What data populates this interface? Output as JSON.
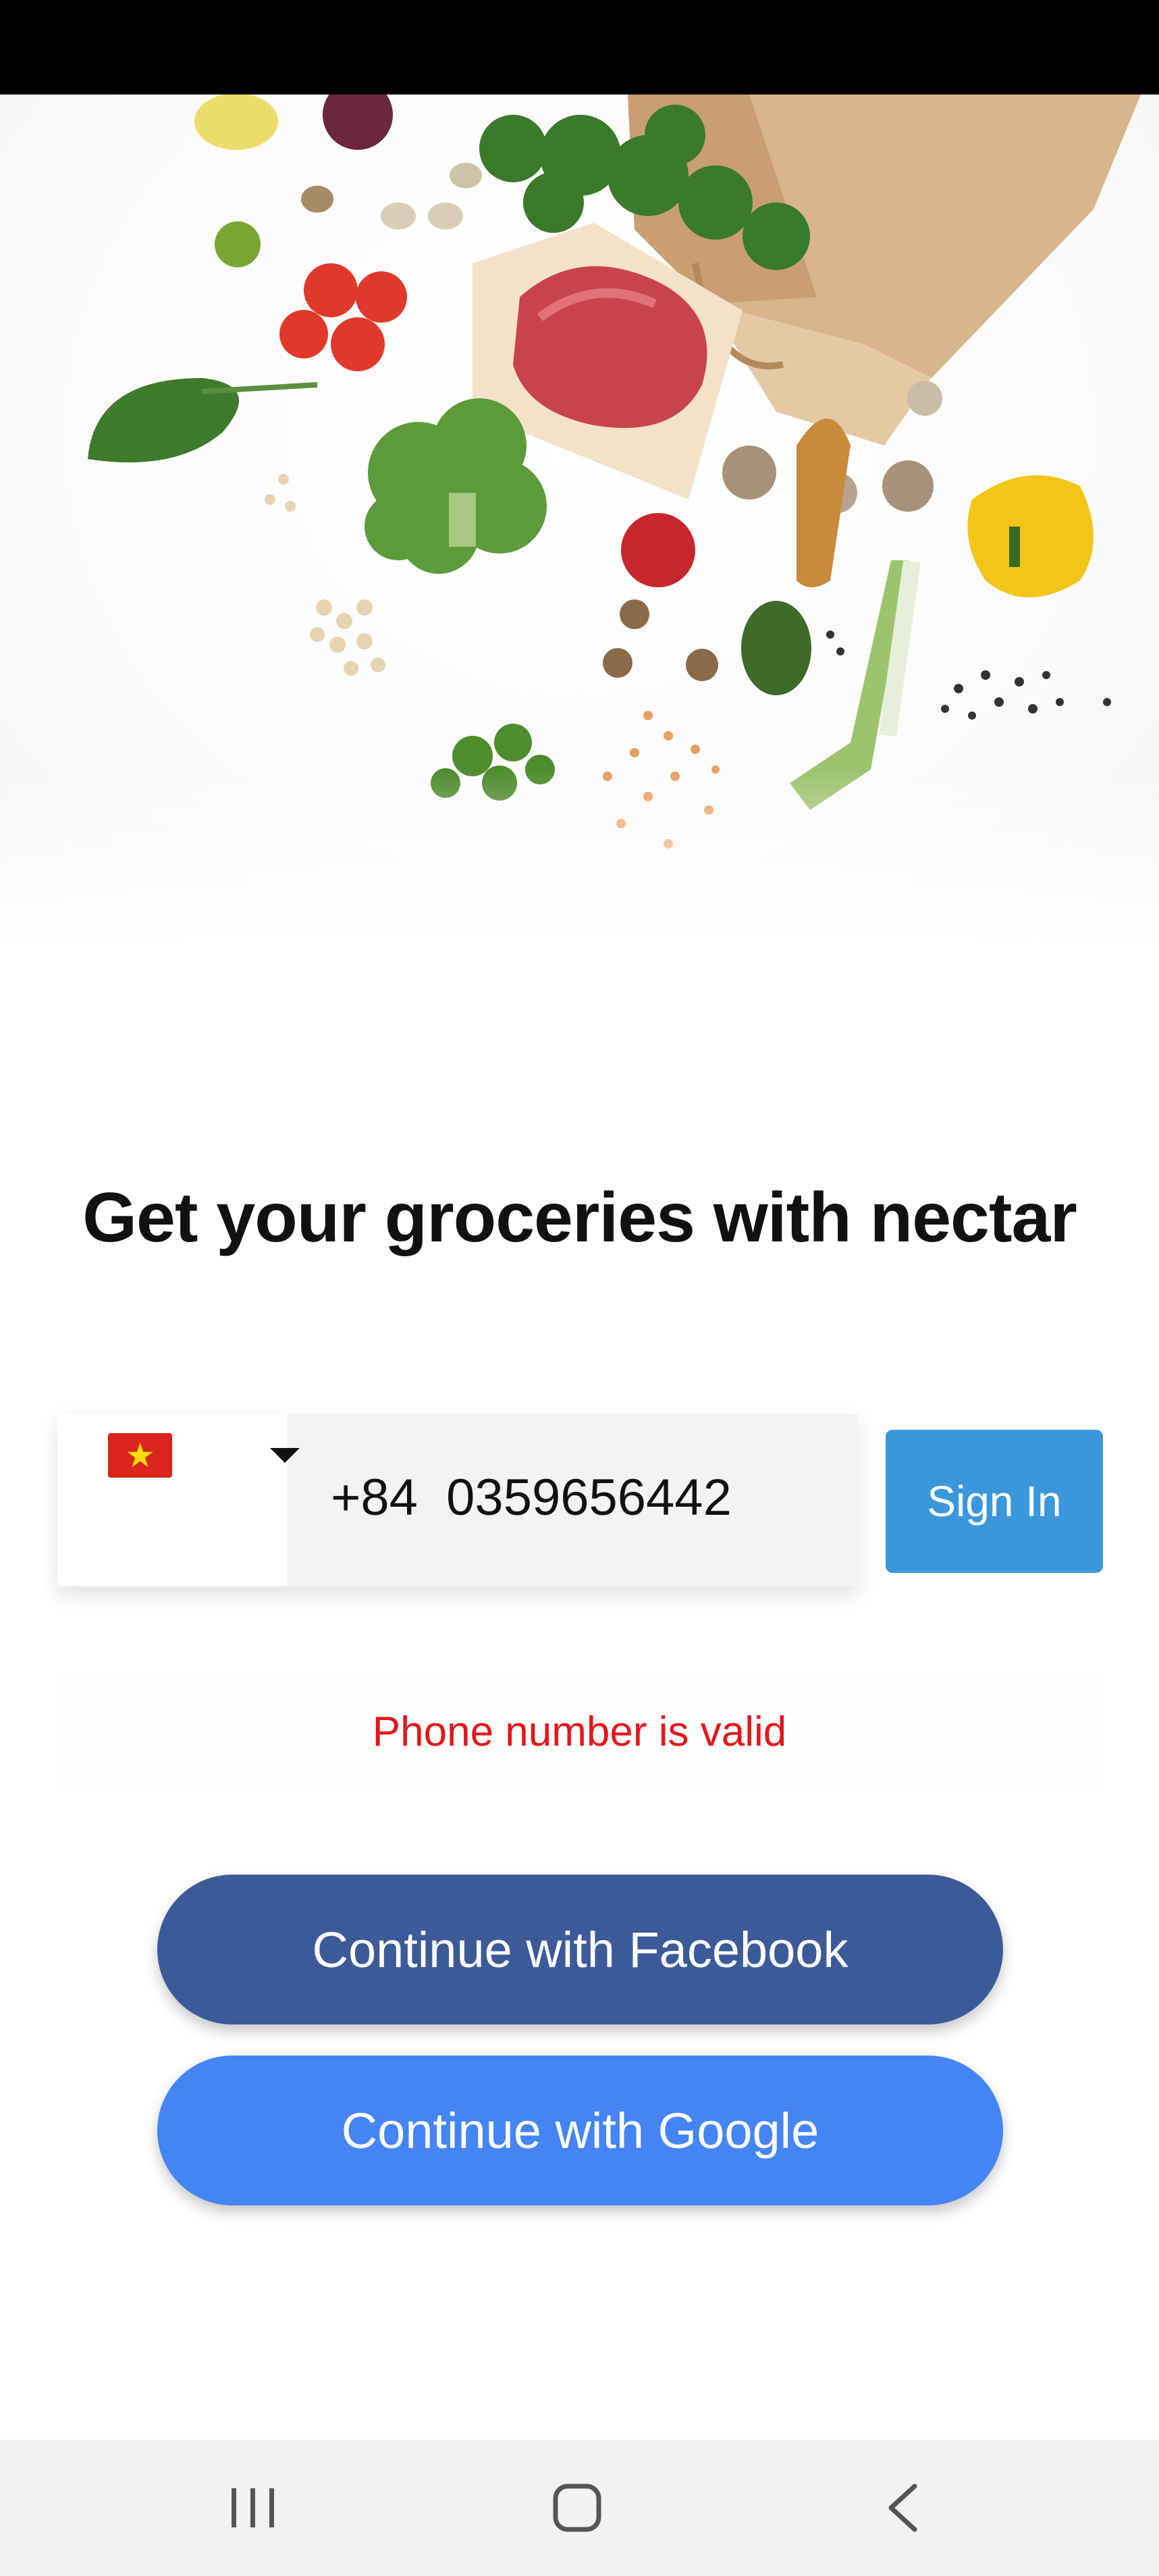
{
  "hero": {
    "image_alt": "groceries spilling from a paper bag"
  },
  "headline": "Get your groceries with nectar",
  "phone_form": {
    "country_flag": "vietnam-flag",
    "country_code": "+84",
    "phone_number": "0359656442",
    "sign_in_label": "Sign In"
  },
  "validation_message": "Phone number is valid",
  "buttons": {
    "facebook": "Continue with Facebook",
    "google": "Continue with Google"
  },
  "colors": {
    "sign_in": "#3b97dc",
    "facebook": "#3d5a98",
    "google": "#4485f3",
    "error_text": "#e4161b"
  },
  "nav": [
    "recent-apps-icon",
    "home-icon",
    "back-icon"
  ]
}
